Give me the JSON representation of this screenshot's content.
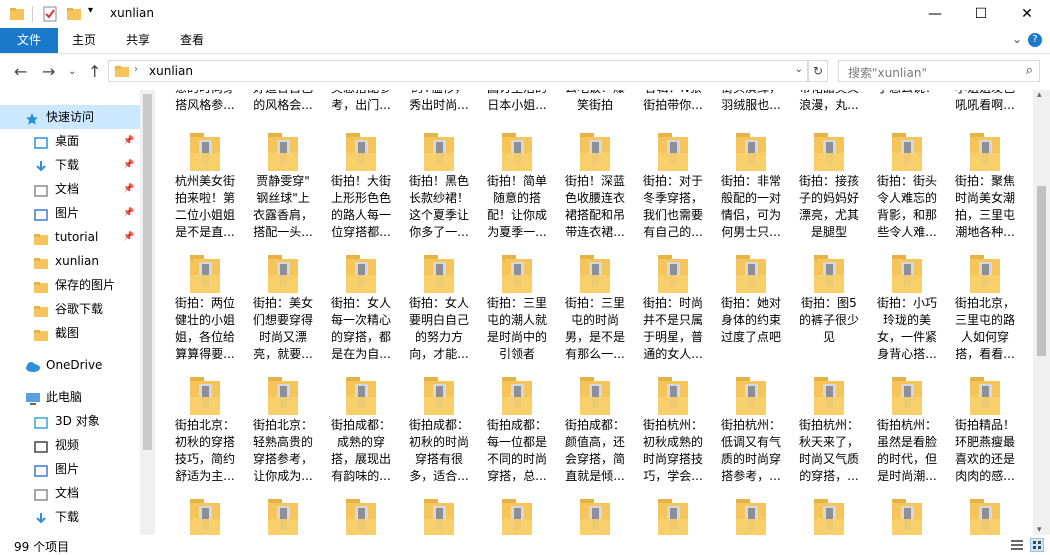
{
  "window": {
    "title": "xunlian"
  },
  "colors": {
    "accent": "#1979ca",
    "folder": "#f5c55b",
    "selected": "#cce8ff"
  },
  "ribbon": {
    "tabs": [
      "文件",
      "主页",
      "共享",
      "查看"
    ]
  },
  "address": {
    "path": "xunlian"
  },
  "search": {
    "placeholder": "搜索\"xunlian\""
  },
  "sidebar": {
    "quick_access": "快速访问",
    "items": [
      {
        "label": "桌面",
        "icon": "desktop-icon",
        "pinned": true
      },
      {
        "label": "下载",
        "icon": "download-icon",
        "pinned": true
      },
      {
        "label": "文档",
        "icon": "document-icon",
        "pinned": true
      },
      {
        "label": "图片",
        "icon": "picture-icon",
        "pinned": true
      },
      {
        "label": "tutorial",
        "icon": "folder-icon",
        "pinned": true
      },
      {
        "label": "xunlian",
        "icon": "folder-icon",
        "pinned": false
      },
      {
        "label": "保存的图片",
        "icon": "folder-icon",
        "pinned": false
      },
      {
        "label": "谷歌下载",
        "icon": "folder-icon",
        "pinned": false
      },
      {
        "label": "截图",
        "icon": "folder-icon",
        "pinned": false
      }
    ],
    "onedrive": "OneDrive",
    "this_pc": "此电脑",
    "pc_items": [
      {
        "label": "3D 对象",
        "icon": "3d-objects-icon"
      },
      {
        "label": "视频",
        "icon": "video-icon"
      },
      {
        "label": "图片",
        "icon": "picture-icon"
      },
      {
        "label": "文档",
        "icon": "document-icon"
      },
      {
        "label": "下载",
        "icon": "download-icon"
      }
    ]
  },
  "rows": [
    [
      "意的时尚穿\n搭风格参...",
      "好造合自己\n的风格会...",
      "美感搭配参\n考，出门...",
      "的T恤衫，\n秀出时尚...",
      "国讨生活的\n日本小姐...",
      "么吃饭？爆\n笑街拍",
      "合辑：N张\n街拍带你...",
      "街头演绎，\n羽绒服也...",
      "带裙甜美义\n浪漫，丸...",
      "子怎么说！",
      "小姐姐发色\n吼吼看啊..."
    ],
    [
      "杭州美女街\n拍来啦！第\n二位小姐姐\n是不是直...",
      "贾静雯穿\"\n钢丝球\"上\n衣露香肩，\n搭配一头...",
      "街拍！大街\n上形形色色\n的路人每一\n位穿搭都...",
      "街拍！黑色\n长款纱裙！\n这个夏季让\n你多了一...",
      "街拍！简单\n随意的搭\n配！让你成\n为夏季一...",
      "街拍！深蓝\n色收腰连衣\n裙搭配和吊\n带连衣裙...",
      "街拍：对于\n冬季穿搭，\n我们也需要\n有自己的...",
      "街拍：非常\n般配的一对\n情侣，可为\n何男士只...",
      "街拍：接孩\n子的妈妈好\n漂亮，尤其\n是腿型",
      "街拍：街头\n令人难忘的\n背影，和那\n些令人难...",
      "街拍：聚焦\n时尚美女潮\n拍，三里屯\n潮地各种..."
    ],
    [
      "街拍：两位\n健壮的小姐\n姐，各位给\n算算得要...",
      "街拍：美女\n们想要穿得\n时尚又漂\n亮，就要...",
      "街拍：女人\n每一次精心\n的穿搭，都\n是在为自...",
      "街拍：女人\n要明白自己\n的努力方\n向，才能...",
      "街拍：三里\n屯的潮人就\n是时尚中的\n引领者",
      "街拍：三里\n屯的时尚\n男，是不是\n有那么一...",
      "街拍：时尚\n并不是只属\n于明星，普\n通的女人...",
      "街拍：她对\n身体的约束\n过度了点吧",
      "街拍：图5\n的裤子很少\n见",
      "街拍：小巧\n玲珑的美\n女，一件紧\n身背心搭...",
      "街拍北京，\n三里屯的路\n人如何穿\n搭，看看..."
    ],
    [
      "街拍北京：\n初秋的穿搭\n技巧，简约\n舒适为主...",
      "街拍北京：\n轻熟高贵的\n穿搭参考，\n让你成为...",
      "街拍成都：\n成熟的穿\n搭，展现出\n有韵味的...",
      "街拍成都：\n初秋的时尚\n穿搭有很\n多，适合...",
      "街拍成都：\n每一位都是\n不同的时尚\n穿搭，总...",
      "街拍成都：\n颜值高，还\n会穿搭，简\n直就是倾...",
      "街拍杭州：\n初秋成熟的\n时尚穿搭技\n巧，学会...",
      "街拍杭州：\n低调又有气\n质的时尚穿\n搭参考，...",
      "街拍杭州：\n秋天来了，\n时尚又气质\n的穿搭，...",
      "街拍杭州：\n虽然是看脸\n的时代，但\n是时尚潮...",
      "街拍精品！\n环肥燕瘦最\n喜欢的还是\n肉肉的感..."
    ],
    [
      "",
      "",
      "",
      "",
      "",
      "",
      "",
      "",
      "",
      "",
      ""
    ]
  ],
  "status": {
    "count": "99 个项目"
  }
}
